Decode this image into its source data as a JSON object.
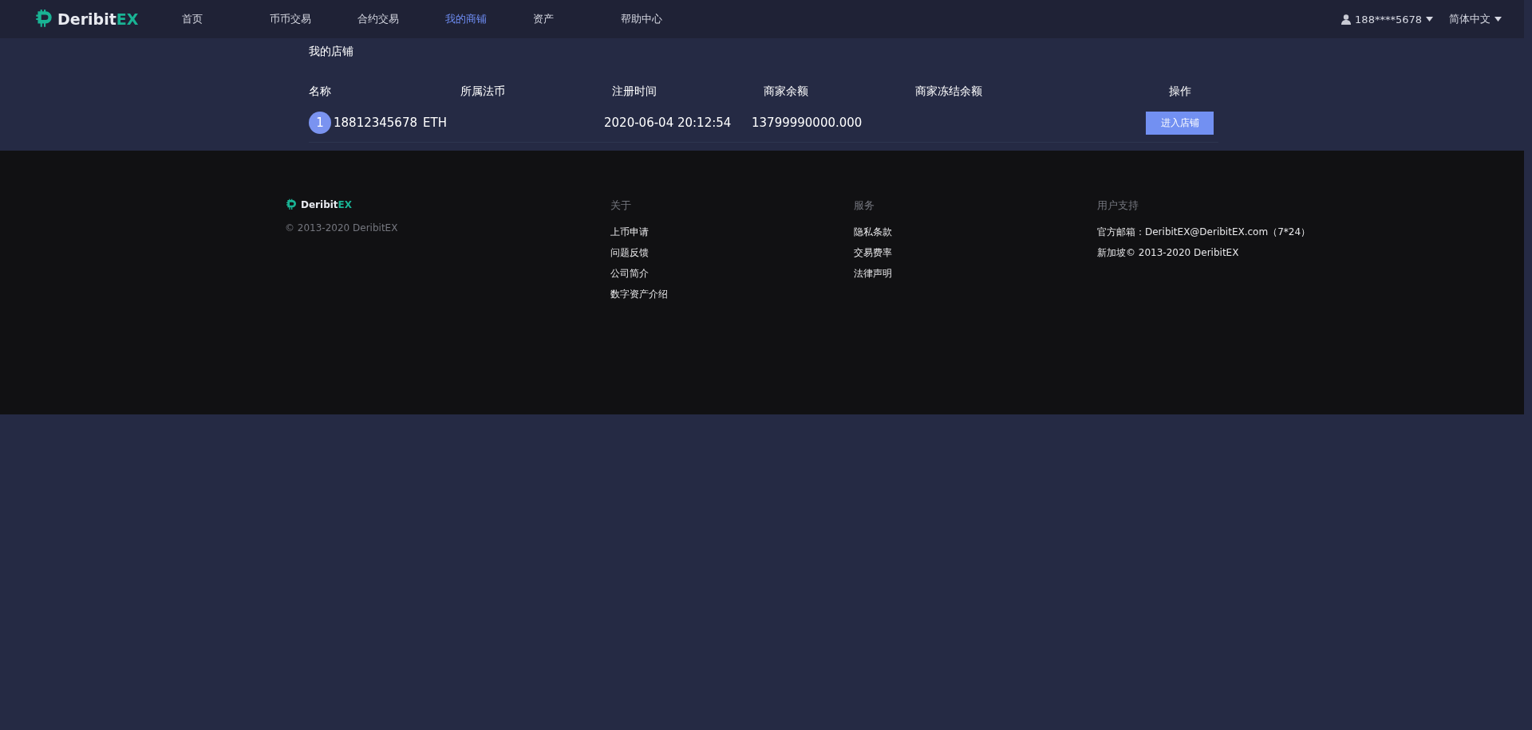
{
  "header": {
    "brand": {
      "name": "Deribit",
      "suffix": "EX"
    },
    "nav": [
      {
        "label": "首页",
        "selected": false
      },
      {
        "label": "币币交易",
        "selected": false
      },
      {
        "label": "合约交易",
        "selected": false
      },
      {
        "label": "我的商铺",
        "selected": true
      },
      {
        "label": "资产",
        "selected": false
      },
      {
        "label": "帮助中心",
        "selected": false
      }
    ],
    "user": "188****5678",
    "language": "简体中文"
  },
  "shop": {
    "title": "我的店铺",
    "columns": [
      "名称",
      "所属法币",
      "注册时间",
      "商家余额",
      "商家冻结余额",
      "操作"
    ],
    "rows": [
      {
        "index": "1",
        "name": "18812345678",
        "currency": "ETH",
        "registered": "2020-06-04 20:12:54",
        "balance": "13799990000.000",
        "action": "进入店铺"
      }
    ]
  },
  "footer": {
    "brand": {
      "name": "Deribit",
      "suffix": "EX"
    },
    "copyright": "© 2013-2020 DeribitEX",
    "columns": [
      {
        "title": "关于",
        "items": [
          "上币申请",
          "问题反馈",
          "公司简介",
          "数字资产介绍"
        ]
      },
      {
        "title": "服务",
        "items": [
          "隐私条款",
          "交易费率",
          "法律声明"
        ]
      },
      {
        "title": "用户支持",
        "items": [
          "官方邮箱：DeribitEX@DeribitEX.com（7*24）",
          "新加坡© 2013-2020 DeribitEX"
        ]
      }
    ]
  }
}
